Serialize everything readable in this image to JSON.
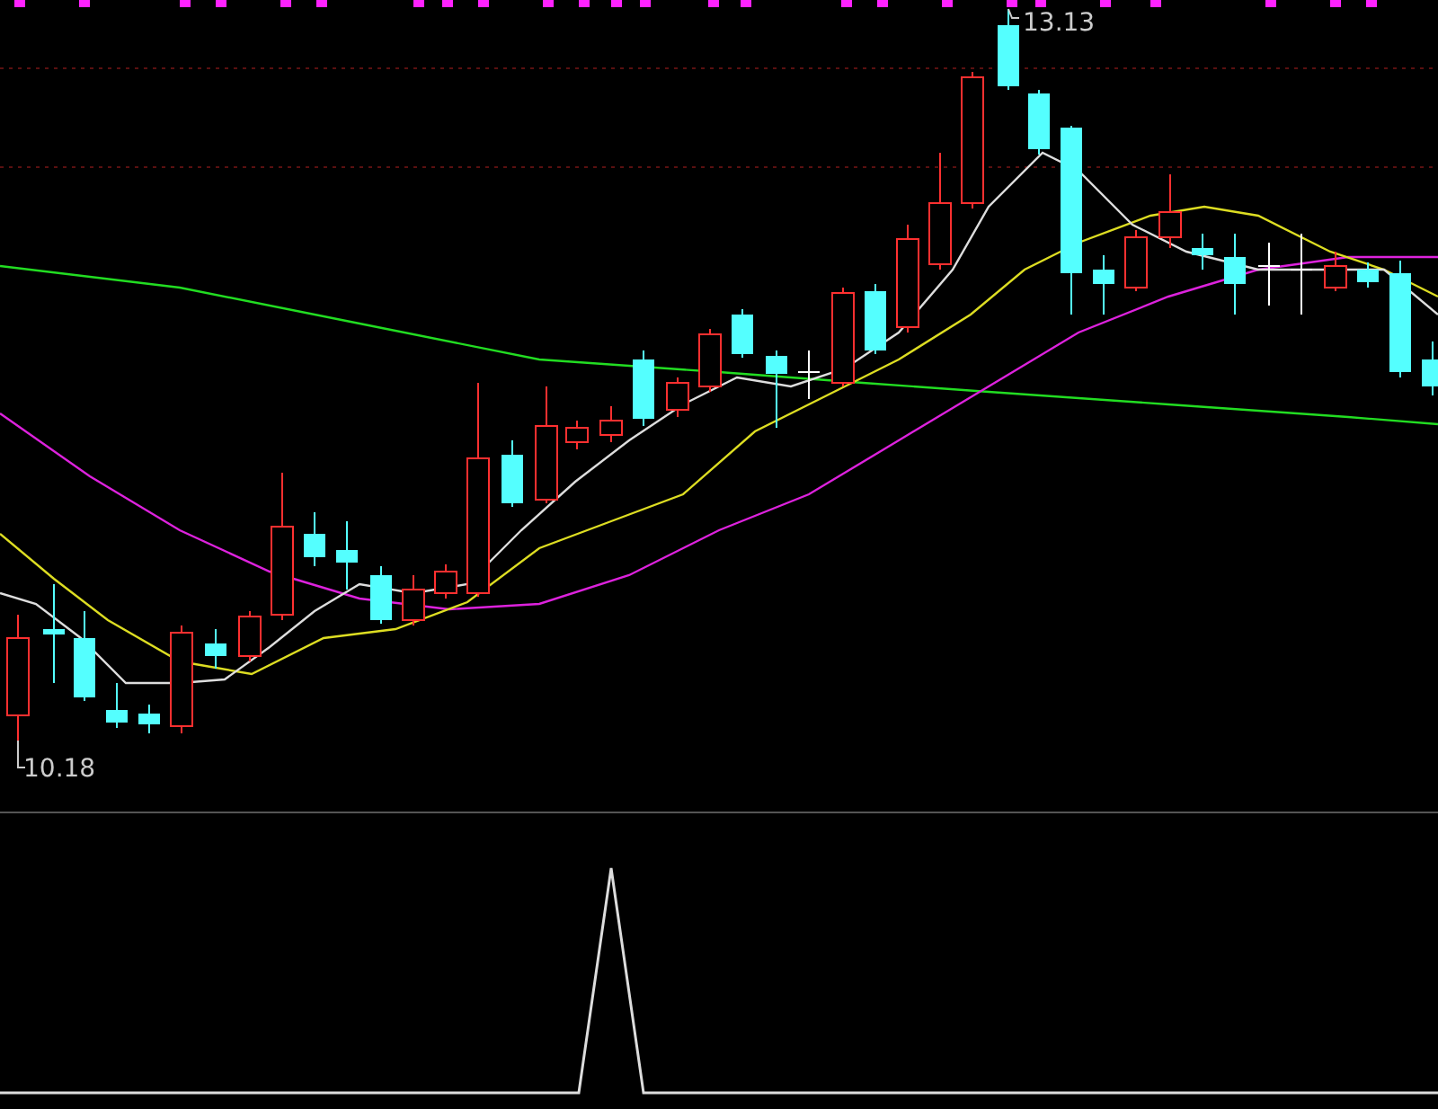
{
  "price_chart": {
    "high_label": "13.13",
    "low_label": "10.18"
  }
}
